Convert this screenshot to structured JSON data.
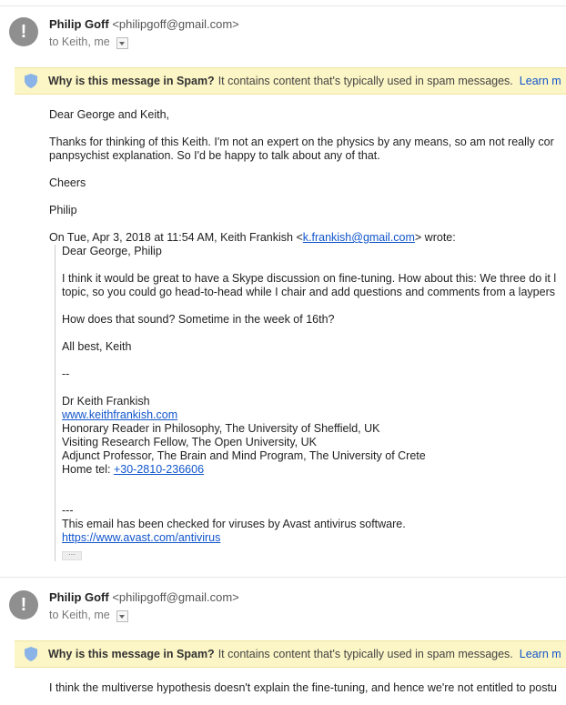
{
  "messages": [
    {
      "sender_name": "Philip Goff",
      "sender_email": "<philipgoff@gmail.com>",
      "recipients": "to Keith, me",
      "spam_question": "Why is this message in Spam?",
      "spam_text": "It contains content that's typically used in spam messages.",
      "spam_learn": "Learn m"
    },
    {
      "sender_name": "Philip Goff",
      "sender_email": "<philipgoff@gmail.com>",
      "recipients": "to Keith, me",
      "spam_question": "Why is this message in Spam?",
      "spam_text": "It contains content that's typically used in spam messages.",
      "spam_learn": "Learn m"
    }
  ],
  "body1": {
    "greeting": "Dear George and Keith,",
    "para1_line1": "Thanks for thinking of this Keith. I'm not an expert on the physics by any means, so am not really cor",
    "para1_line2": "panpsychist explanation. So I'd be happy to talk about any of that.",
    "cheers": "Cheers",
    "signoff": "Philip",
    "quote_header_prefix": "On Tue, Apr 3, 2018 at 11:54 AM, Keith Frankish <",
    "quote_header_email": "k.frankish@gmail.com",
    "quote_header_suffix": "> wrote:",
    "quote": {
      "greeting": "Dear George, Philip",
      "para_line1": "I think it would be great to have a Skype discussion on fine-tuning. How about this: We three do it l",
      "para_line2": "topic, so you could go head-to-head while I chair and add questions and comments from a laypers",
      "question": "How does that sound? Sometime in the week of 16th?",
      "closing": "All best, Keith",
      "dashes": "--",
      "sig_name": "Dr Keith Frankish",
      "sig_site": "www.keithfrankish.com",
      "sig_line1": "Honorary Reader in Philosophy, The University of Sheffield, UK",
      "sig_line2": "Visiting Research Fellow, The Open University, UK",
      "sig_line3": "Adjunct Professor, The Brain and Mind Program, The University of Crete",
      "home_tel_label": "Home tel: ",
      "home_tel": "+30-2810-236606",
      "sep": "---",
      "avast_text": "This email has been checked for viruses by Avast antivirus software.",
      "avast_link": "https://www.avast.com/antivirus",
      "more": "···"
    }
  },
  "body2": {
    "line1": "I think the multiverse hypothesis doesn't explain the fine-tuning, and hence we're not entitled to postu"
  },
  "icons": {
    "avatar": "alert-avatar-icon",
    "shield": "shield-icon",
    "dropdown": "chevron-down-icon"
  },
  "colors": {
    "spam_bg": "#fcf5c5",
    "link": "#1155cc",
    "shield": "#8ab4e8",
    "avatar": "#8f8f8f"
  }
}
